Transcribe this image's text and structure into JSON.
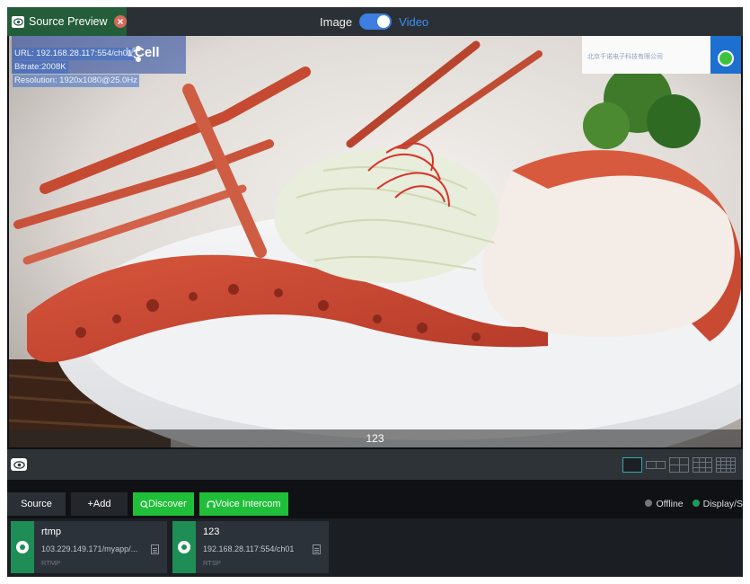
{
  "topbar": {
    "tab_label": "Source Preview",
    "mode_image": "Image",
    "mode_video": "Video",
    "mode_selected": "Video"
  },
  "preview": {
    "overlay_url": "URL: 192.168.28.117:554/ch01",
    "overlay_bitrate": "Bitrate:2008K",
    "overlay_resolution": "Resolution: 1920x1080@25.0Hz",
    "vcell_text": "VCell",
    "brand_text": "北京千诺电子科技有限公司",
    "caption": "123"
  },
  "viewbar": {
    "layouts": [
      "1x1",
      "1x2",
      "2x2",
      "3x3",
      "4x4"
    ],
    "active_layout": "1x1"
  },
  "sourcebar": {
    "source_label": "Source",
    "add_label": "+Add",
    "discover_label": "Discover",
    "voice_label": "Voice Intercom",
    "legend_offline": "Offline",
    "legend_display": "Display/S"
  },
  "sources": [
    {
      "name": "rtmp",
      "address": "103.229.149.171/myapp/...",
      "protocol": "RTMP"
    },
    {
      "name": "123",
      "address": "192.168.28.117:554/ch01",
      "protocol": "RTSP"
    }
  ],
  "colors": {
    "accent_green": "#1fbf3a",
    "accent_blue": "#3d7ee0",
    "card_green": "#1f8d56",
    "offline": "#777777",
    "display": "#1f9a5a"
  }
}
